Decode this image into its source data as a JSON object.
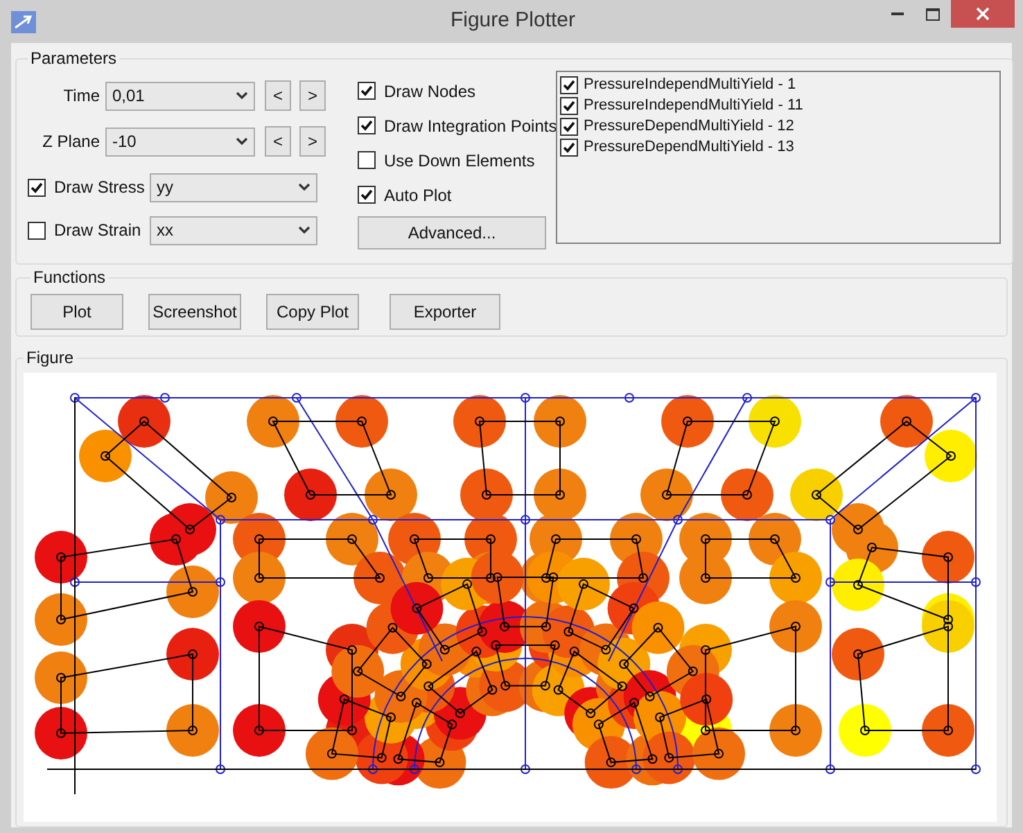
{
  "window": {
    "title": "Figure Plotter"
  },
  "parameters": {
    "title": "Parameters",
    "time": {
      "label": "Time",
      "value": "0,01",
      "prev": "<",
      "next": ">"
    },
    "z_plane": {
      "label": "Z Plane",
      "value": "-10",
      "prev": "<",
      "next": ">"
    },
    "draw_stress": {
      "label": "Draw Stress",
      "checked": true,
      "value": "yy"
    },
    "draw_strain": {
      "label": "Draw Strain",
      "checked": false,
      "value": "xx"
    },
    "options": [
      {
        "label": "Draw Nodes",
        "checked": true
      },
      {
        "label": "Draw Integration Points",
        "checked": true
      },
      {
        "label": "Use Down Elements",
        "checked": false
      },
      {
        "label": "Auto Plot",
        "checked": true
      }
    ],
    "advanced_button": "Advanced...",
    "materials": [
      {
        "label": "PressureIndependMultiYield - 1",
        "checked": true
      },
      {
        "label": "PressureIndependMultiYield - 11",
        "checked": true
      },
      {
        "label": "PressureDependMultiYield - 12",
        "checked": true
      },
      {
        "label": "PressureDependMultiYield - 13",
        "checked": true
      }
    ]
  },
  "functions": {
    "title": "Functions",
    "buttons": [
      "Plot",
      "Screenshot",
      "Copy Plot",
      "Exporter"
    ]
  },
  "figure": {
    "title": "Figure"
  }
}
